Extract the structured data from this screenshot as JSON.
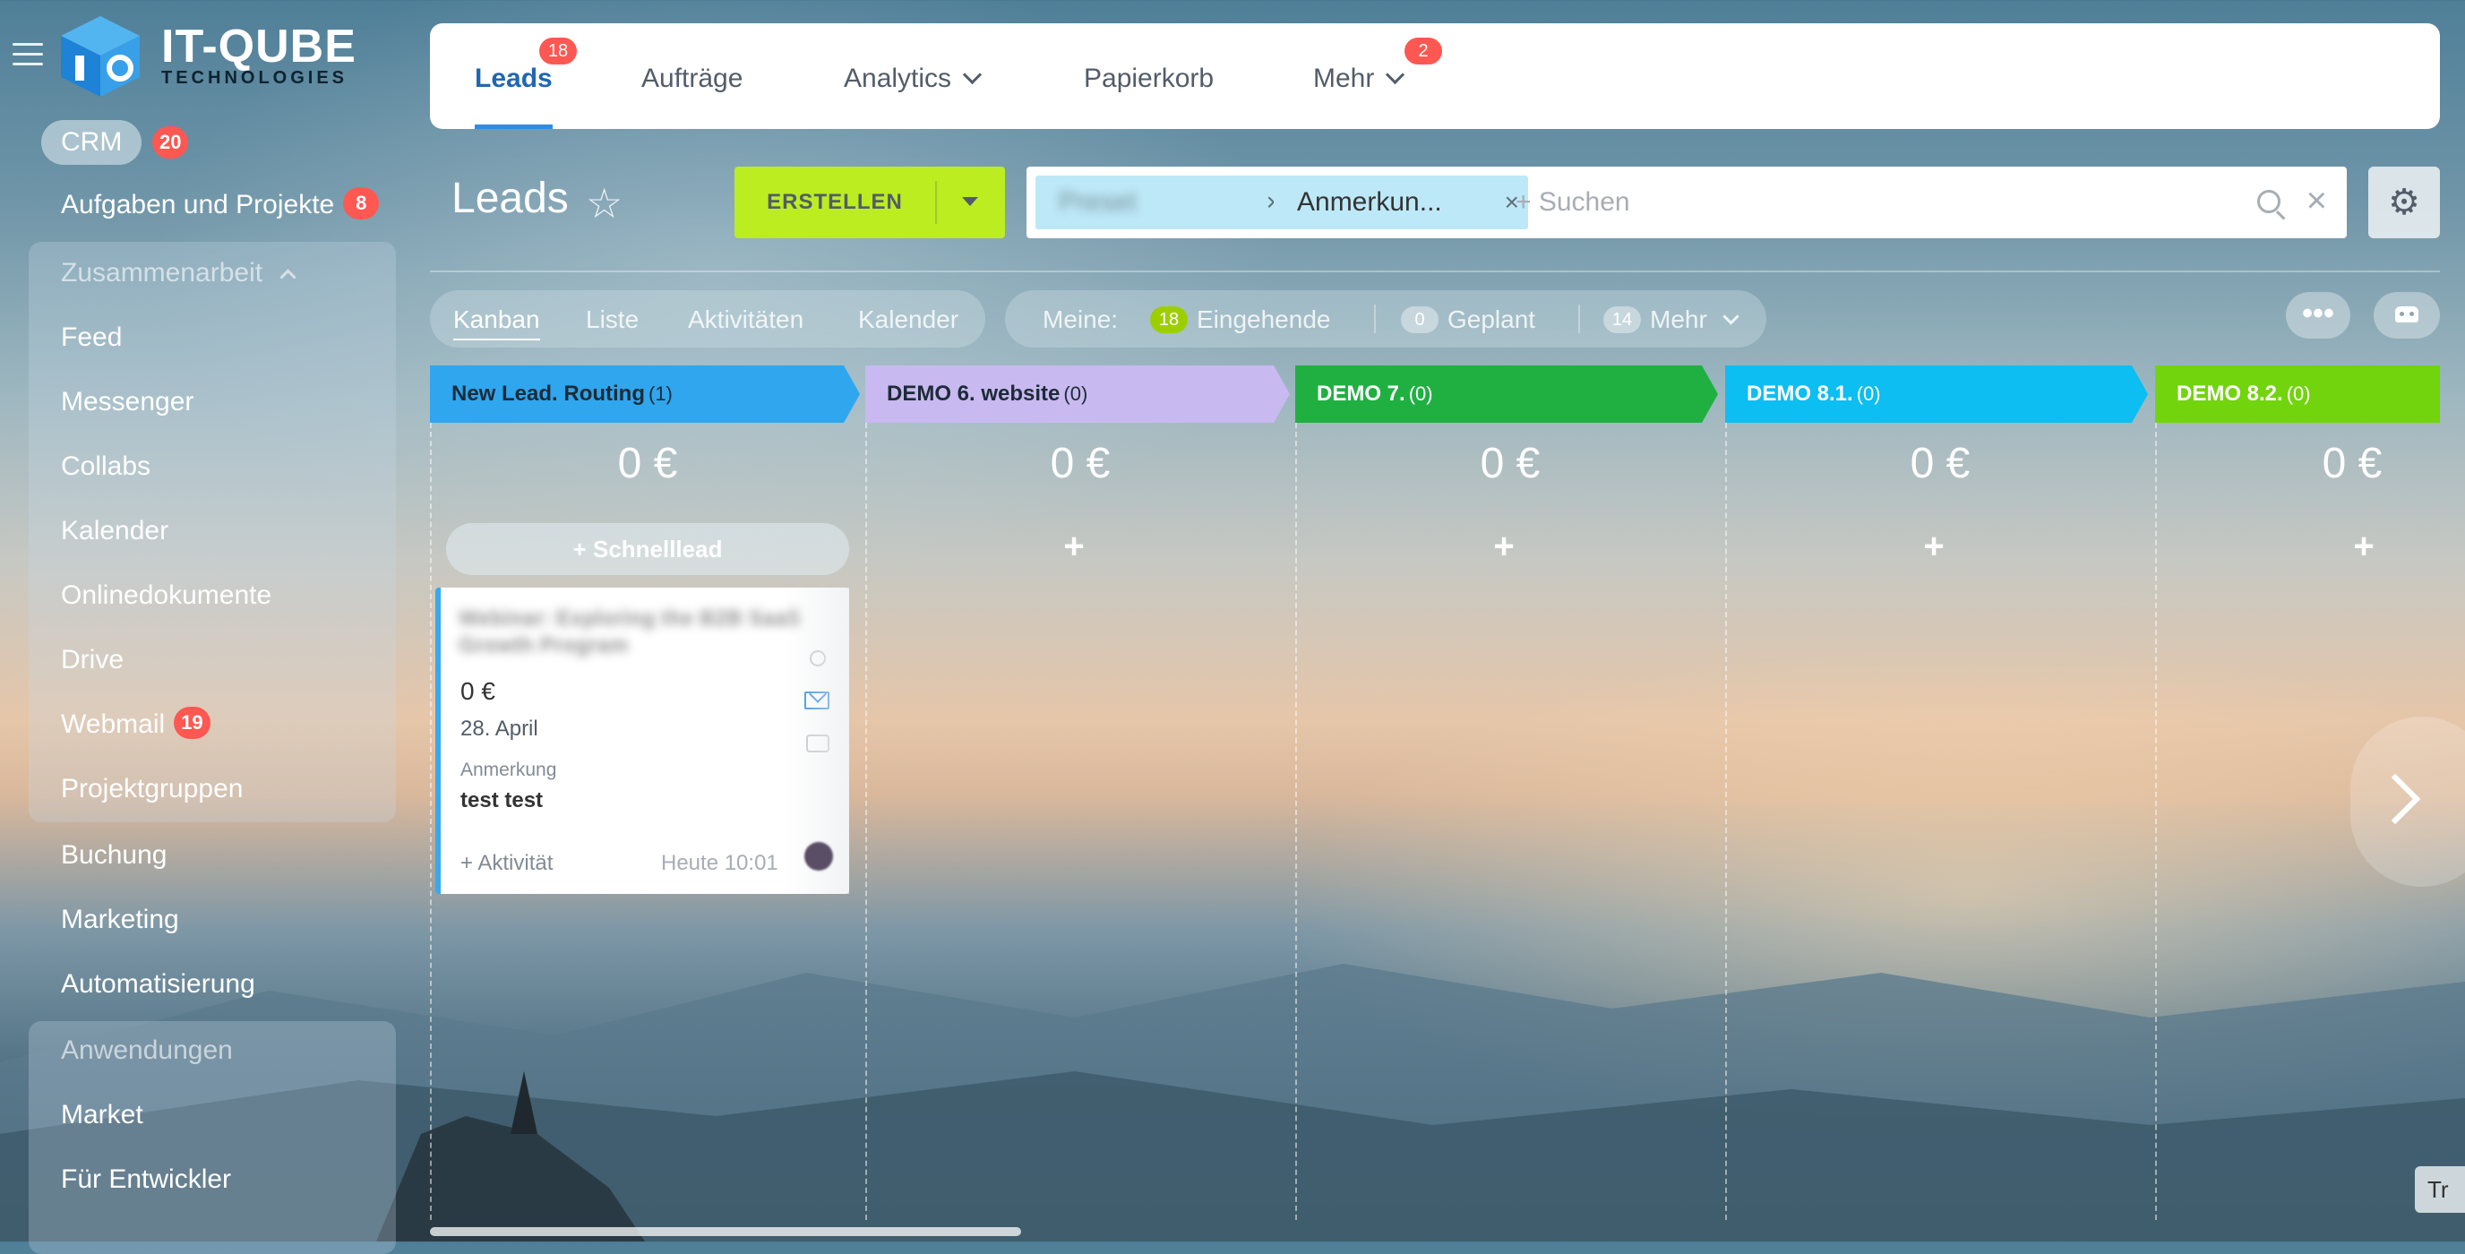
{
  "sidebar": {
    "logo_title": "IT-QUBE",
    "logo_subtitle": "TECHNOLOGIES",
    "crm_label": "CRM",
    "crm_badge": "20",
    "tasks_label": "Aufgaben und Projekte",
    "tasks_badge": "8",
    "collab_group_title": "Zusammenarbeit",
    "collab_items": [
      "Feed",
      "Messenger",
      "Collabs",
      "Kalender",
      "Onlinedokumente",
      "Drive",
      "Webmail",
      "Projektgruppen"
    ],
    "webmail_badge": "19",
    "items_after": [
      "Buchung",
      "Marketing",
      "Automatisierung"
    ],
    "apps_group_title": "Anwendungen",
    "apps_items": [
      "Market",
      "Für Entwickler"
    ]
  },
  "tabs": [
    {
      "label": "Leads",
      "badge": "18",
      "active": true
    },
    {
      "label": "Aufträge"
    },
    {
      "label": "Analytics",
      "dropdown": true
    },
    {
      "label": "Papierkorb"
    },
    {
      "label": "Mehr",
      "badge": "2",
      "dropdown": true
    }
  ],
  "page": {
    "title": "Leads",
    "create_label": "ERSTELLEN",
    "search_chip_2": "Anmerkun...",
    "search_placeholder": "+ Suchen"
  },
  "views": [
    "Kanban",
    "Liste",
    "Aktivitäten",
    "Kalender"
  ],
  "active_view": "Kanban",
  "counters": {
    "meine_label": "Meine:",
    "incoming_count": "18",
    "incoming_label": "Eingehende",
    "planned_count": "0",
    "planned_label": "Geplant",
    "more_count": "14",
    "more_label": "Mehr"
  },
  "columns": [
    {
      "title": "New Lead. Routing",
      "count": "(1)",
      "sum": "0 €",
      "color": "#2fa6ee",
      "text_color": "#1d2b36"
    },
    {
      "title": "DEMO 6. website",
      "count": "(0)",
      "sum": "0 €",
      "color": "#c8b9f0",
      "text_color": "#1d2b36"
    },
    {
      "title": "DEMO 7.",
      "count": "(0)",
      "sum": "0 €",
      "color": "#20b042",
      "text_color": "#ffffff"
    },
    {
      "title": "DEMO 8.1.",
      "count": "(0)",
      "sum": "0 €",
      "color": "#0cbef2",
      "text_color": "#ffffff"
    },
    {
      "title": "DEMO 8.2.",
      "count": "(0)",
      "sum": "0 €",
      "color": "#72d40d",
      "text_color": "#ffffff"
    }
  ],
  "quick_lead_label": "Schnelllead",
  "card": {
    "amount": "0 €",
    "date": "28. April",
    "field_label": "Anmerkung",
    "field_value": "test test",
    "activity_label": "+ Aktivität",
    "time": "Heute 10:01"
  },
  "edge_tab_label": "Tr"
}
